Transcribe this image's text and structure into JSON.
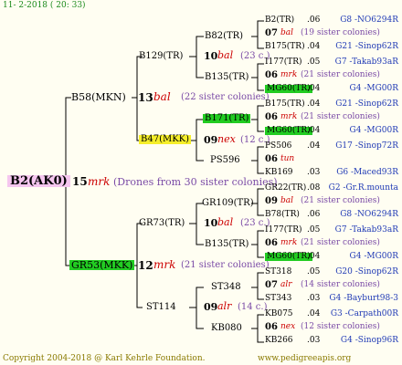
{
  "header": {
    "date": "11- 2-2018 ( 20: 33)"
  },
  "footer": {
    "copyright": "Copyright 2004-2018 @ Karl Kehrle Foundation.",
    "site": "www.pedigreeapis.org"
  },
  "root": {
    "name": "B2(AK0)",
    "year": "15",
    "breed": "mrk",
    "note": "(Drones from 30 sister colonies)"
  },
  "gen1": [
    {
      "name": "B58(MKN)",
      "year": "13",
      "breed": "bal",
      "note": "(22 sister colonies)"
    },
    {
      "name": "GR53(MKK)",
      "year": "12",
      "breed": "mrk",
      "note": "(21 sister colonies)"
    }
  ],
  "gen2": [
    {
      "name": "B129(TR)",
      "year": "10",
      "breed": "bal",
      "note": "(23 c.)"
    },
    {
      "name": "B47(MKK)",
      "year": "09",
      "breed": "nex",
      "note": "(12 c.)"
    },
    {
      "name": "GR73(TR)",
      "year": "10",
      "breed": "bal",
      "note": "(23 c.)"
    },
    {
      "name": "ST114",
      "year": "09",
      "breed": "alr",
      "note": "(14 c.)"
    }
  ],
  "gen3": [
    "B82(TR)",
    "B135(TR)",
    "B171(TR)",
    "PS596",
    "GR109(TR)",
    "B135(TR)",
    "ST348",
    "KB080"
  ],
  "gen4": [
    {
      "name": "B2(TR)",
      "num": ".06",
      "right": "G8 -NO6294R",
      "sex": false
    },
    {
      "name": "07",
      "breed": "bal",
      "note": "(19 sister colonies)",
      "sex": true
    },
    {
      "name": "B175(TR)",
      "num": ".04",
      "right": "G21 -Sinop62R",
      "sex": false
    },
    {
      "name": "I177(TR)",
      "num": ".05",
      "right": "G7 -Takab93aR",
      "sex": false
    },
    {
      "name": "06",
      "breed": "mrk",
      "note": "(21 sister colonies)",
      "sex": true
    },
    {
      "name": "MG60(TR)",
      "num": ".04",
      "right": "G4 -MG00R",
      "sex": false
    },
    {
      "name": "B175(TR)",
      "num": ".04",
      "right": "G21 -Sinop62R",
      "sex": false
    },
    {
      "name": "06",
      "breed": "mrk",
      "note": "(21 sister colonies)",
      "sex": true
    },
    {
      "name": "MG60(TR)",
      "num": ".04",
      "right": "G4 -MG00R",
      "sex": false
    },
    {
      "name": "PS506",
      "num": ".04",
      "right": "G17 -Sinop72R",
      "sex": false
    },
    {
      "name": "06",
      "breed": "tun",
      "note": "",
      "sex": true
    },
    {
      "name": "KB169",
      "num": ".03",
      "right": "G6 -Maced93R",
      "sex": false
    },
    {
      "name": "GR22(TR)",
      "num": ".08",
      "right": "G2 -Gr.R.mounta",
      "sex": false
    },
    {
      "name": "09",
      "breed": "bal",
      "note": "(21 sister colonies)",
      "sex": true
    },
    {
      "name": "B78(TR)",
      "num": ".06",
      "right": "G8 -NO6294R",
      "sex": false
    },
    {
      "name": "I177(TR)",
      "num": ".05",
      "right": "G7 -Takab93aR",
      "sex": false
    },
    {
      "name": "06",
      "breed": "mrk",
      "note": "(21 sister colonies)",
      "sex": true
    },
    {
      "name": "MG60(TR)",
      "num": ".04",
      "right": "G4 -MG00R",
      "sex": false
    },
    {
      "name": "ST318",
      "num": ".05",
      "right": "G20 -Sinop62R",
      "sex": false
    },
    {
      "name": "07",
      "breed": "alr",
      "note": "(14 sister colonies)",
      "sex": true
    },
    {
      "name": "ST343",
      "num": ".03",
      "right": "G4 -Bayburt98-3",
      "sex": false
    },
    {
      "name": "KB075",
      "num": ".04",
      "right": "G3 -Carpath00R",
      "sex": false
    },
    {
      "name": "06",
      "breed": "nex",
      "note": "(12 sister colonies)",
      "sex": true
    },
    {
      "name": "KB266",
      "num": ".03",
      "right": "G4 -Sinop96R",
      "sex": false
    }
  ],
  "colors": {
    "background": "#fffef2",
    "lines": "#000000",
    "purple_text": "#7a4aa6",
    "blue_text": "#1f39b5",
    "red_text": "#cc0000",
    "highlight_green": "#22cc22",
    "highlight_yellow": "#f5ee2a",
    "highlight_pink": "#f5c6ef"
  }
}
